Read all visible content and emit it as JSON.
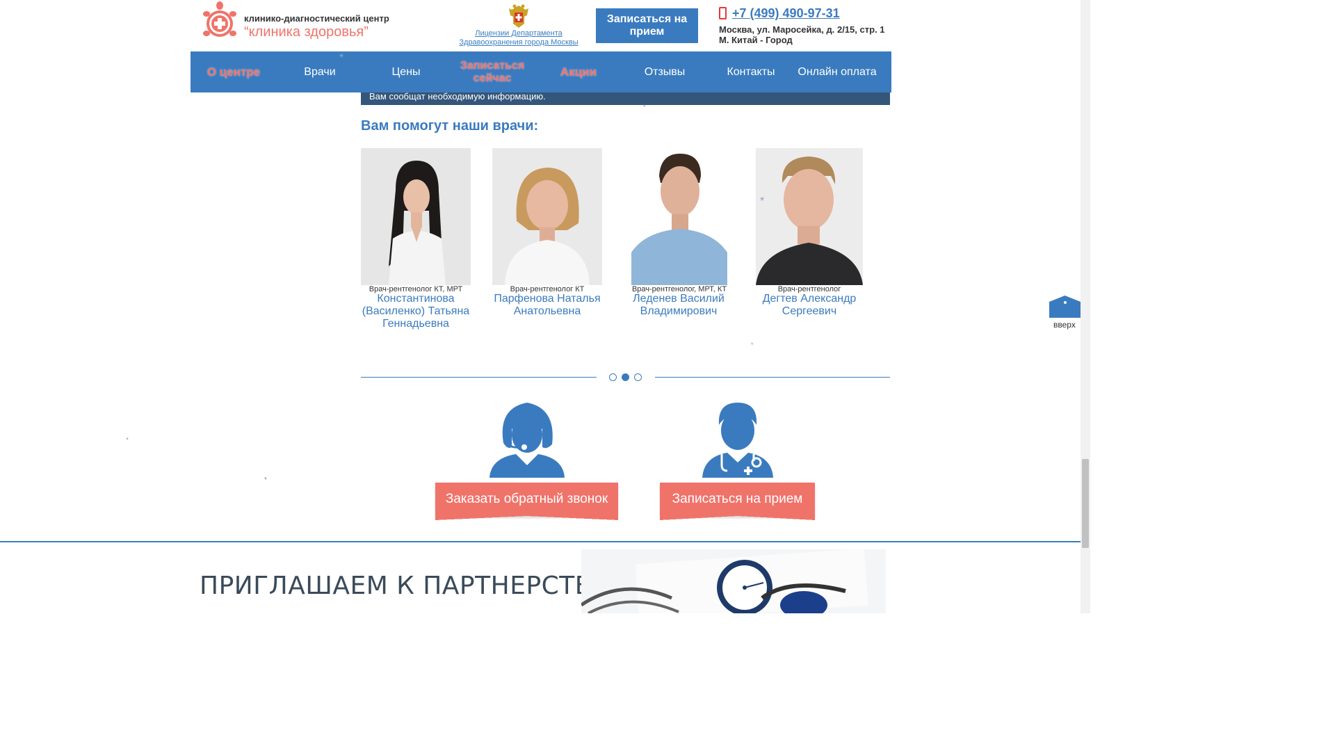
{
  "header": {
    "logo_line1": "клинико-диагностический центр",
    "logo_line2": "“клиника здоровья”",
    "license_line1": "Лицензии Департамента",
    "license_line2": "Здравоохранения города Москвы",
    "book_button": "Записаться на прием",
    "phone": "+7 (499) 490-97-31",
    "address_line1": "Москва, ул. Маросейка, д. 2/15, стр. 1",
    "address_line2": "М. Китай - Город"
  },
  "nav": {
    "items": [
      {
        "label": "О центре"
      },
      {
        "label": "Врачи"
      },
      {
        "label": "Цены"
      },
      {
        "label": "Записаться сейчас"
      },
      {
        "label": "Акции"
      },
      {
        "label": "Отзывы"
      },
      {
        "label": "Контакты"
      },
      {
        "label": "Онлайн оплата"
      }
    ]
  },
  "info_bar": "Вам сообщат необходимую информацию.",
  "doctors_section": {
    "title": "Вам помогут наши врачи:",
    "doctors": [
      {
        "role": "Врач-рентгенолог КТ, МРТ",
        "name": "Константинова (Василенко) Татьяна Геннадьевна"
      },
      {
        "role": "Врач-рентгенолог КТ",
        "name": "Парфенова Наталья Анатольевна"
      },
      {
        "role": "Врач-рентгенолог, МРТ, КТ",
        "name": "Леденев Василий Владимирович"
      },
      {
        "role": "Врач-рентгенолог",
        "name": "Дегтев Александр Сергеевич"
      }
    ],
    "slider_pages": 3,
    "active_page": 2
  },
  "cta": {
    "callback": "Заказать обратный звонок",
    "book": "Записаться на прием"
  },
  "up_button": "вверх",
  "partner_banner": "ПРИГЛАШАЕМ К ПАРТНЕРСТВУ",
  "colors": {
    "brand_blue": "#3a7bbf",
    "accent_coral": "#f0736a",
    "info_bar": "#34567a"
  }
}
